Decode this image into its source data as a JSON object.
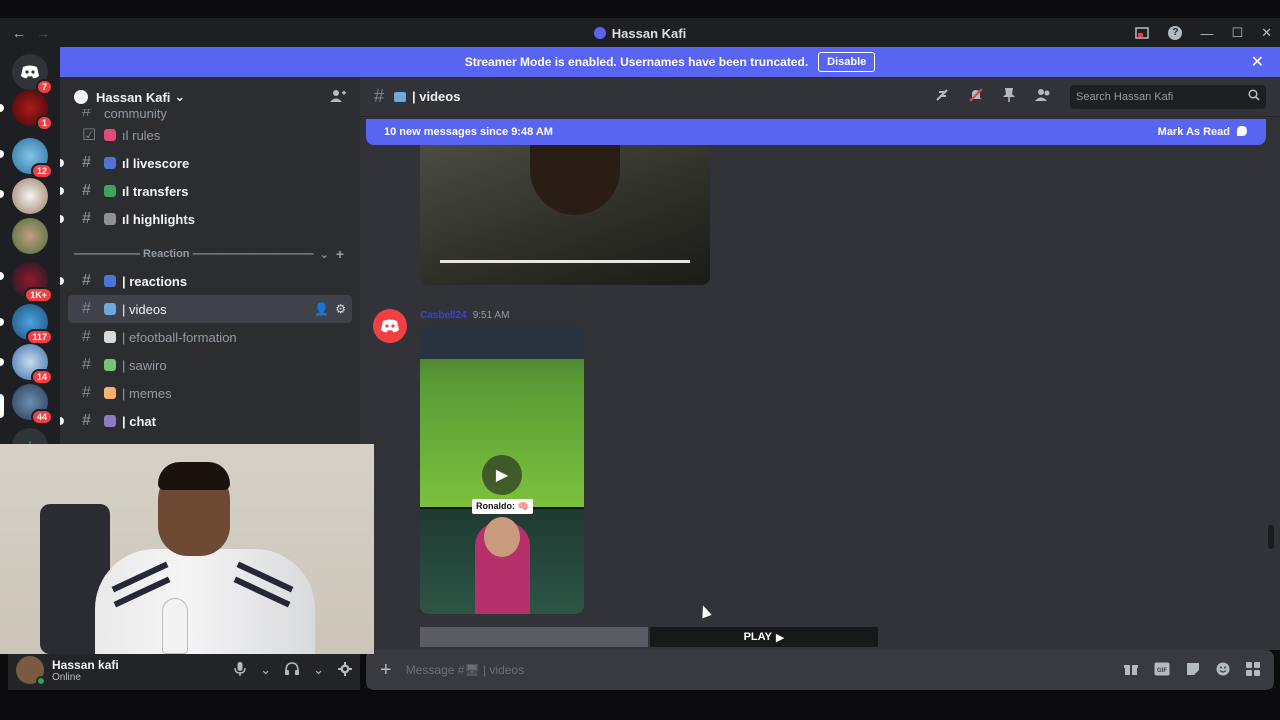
{
  "window": {
    "title": "Hassan Kafi",
    "back": "←",
    "forward": "→",
    "help": "?",
    "minimize": "—",
    "maximize": "☐",
    "close": "✕"
  },
  "rail": {
    "badges": [
      "7",
      "1",
      "12",
      "1K+",
      "117",
      "14",
      "44"
    ],
    "add": "+"
  },
  "banner": {
    "text": "Streamer Mode is enabled. Usernames have been truncated.",
    "disable_label": "Disable",
    "close": "✕"
  },
  "sidebar": {
    "server_name": "Hassan Kafi",
    "chevron": "⌄",
    "partial_channel": "community",
    "channels_top": [
      {
        "icon": "☑",
        "emoji_color": "#e04b7c",
        "label": "ıl rules",
        "state": "normal"
      },
      {
        "icon": "#",
        "emoji_color": "#4f73d6",
        "label": "ıl livescore",
        "state": "unread"
      },
      {
        "icon": "#",
        "emoji_color": "#3ba55c",
        "label": "ıl transfers",
        "state": "unread"
      },
      {
        "icon": "#",
        "emoji_color": "#8e9297",
        "label": "ıl highlights",
        "state": "unread"
      }
    ],
    "category": {
      "label": "—————— Reaction ———————————",
      "chevron": "⌄",
      "plus": "+"
    },
    "channels_bottom": [
      {
        "icon": "#",
        "emoji_color": "#4f73d6",
        "label": "| reactions",
        "state": "unread"
      },
      {
        "icon": "#",
        "emoji_color": "#6fa8dc",
        "label": "| videos",
        "state": "active"
      },
      {
        "icon": "#",
        "emoji_color": "#d9d9d9",
        "label": "| efootball-formation",
        "state": "normal"
      },
      {
        "icon": "#",
        "emoji_color": "#74c476",
        "label": "| sawiro",
        "state": "normal"
      },
      {
        "icon": "#",
        "emoji_color": "#f6b26b",
        "label": "| memes",
        "state": "normal"
      },
      {
        "icon": "#",
        "emoji_color": "#8e7cc3",
        "label": "| chat",
        "state": "unread"
      }
    ]
  },
  "user": {
    "name": "Hassan kafi",
    "status": "Online",
    "mic": "🎙",
    "headset": "🎧",
    "settings": "⚙",
    "caret": "⌄"
  },
  "chat": {
    "channel": "| videos",
    "search_placeholder": "Search Hassan Kafi",
    "new_messages": "10 new messages since 9:48 AM",
    "mark_read": "Mark As Read",
    "message": {
      "author": "Casbell24",
      "time": "9:51 AM",
      "caption": "Ronaldo: 🧠",
      "play_label": "PLAY"
    },
    "composer_placeholder": "Message #🖥 | videos"
  },
  "colors": {
    "accent": "#5865f2",
    "background": "#313338",
    "sidebar": "#2b2d31",
    "rail": "#1e1f22",
    "badge": "#f23f43",
    "online": "#23a55a"
  }
}
